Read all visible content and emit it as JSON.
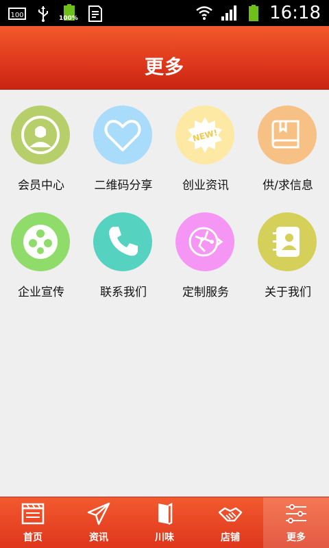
{
  "status_bar": {
    "time": "16:18",
    "battery_text": "100%",
    "icons": [
      "notification-100-icon",
      "usb-icon",
      "battery-100-icon",
      "sim-icon",
      "wifi-icon",
      "signal-icon",
      "battery-icon"
    ]
  },
  "header": {
    "title": "更多"
  },
  "grid": [
    {
      "label": "会员中心",
      "icon": "member-icon",
      "color": "#b7cf6a"
    },
    {
      "label": "二维码分享",
      "icon": "heart-icon",
      "color": "#a9dcfa"
    },
    {
      "label": "创业资讯",
      "icon": "new-badge-icon",
      "color": "#fde9a3"
    },
    {
      "label": "供/求信息",
      "icon": "book-icon",
      "color": "#f7c084"
    },
    {
      "label": "企业宣传",
      "icon": "film-reel-icon",
      "color": "#8fdc6b"
    },
    {
      "label": "联系我们",
      "icon": "phone-icon",
      "color": "#56d2c0"
    },
    {
      "label": "定制服务",
      "icon": "globe-arrow-icon",
      "color": "#f595f4"
    },
    {
      "label": "关于我们",
      "icon": "contacts-book-icon",
      "color": "#d5d05a"
    }
  ],
  "bottom_nav": [
    {
      "label": "首页",
      "icon": "home-clapper-icon",
      "active": false
    },
    {
      "label": "资讯",
      "icon": "paper-plane-icon",
      "active": false
    },
    {
      "label": "川味",
      "icon": "book-spine-icon",
      "active": false
    },
    {
      "label": "店铺",
      "icon": "handshake-icon",
      "active": false
    },
    {
      "label": "更多",
      "icon": "sliders-icon",
      "active": true
    }
  ],
  "colors": {
    "header_top": "#f25a2c",
    "header_bottom": "#c92412",
    "background": "#efefef",
    "nav_text": "#ffffff"
  }
}
